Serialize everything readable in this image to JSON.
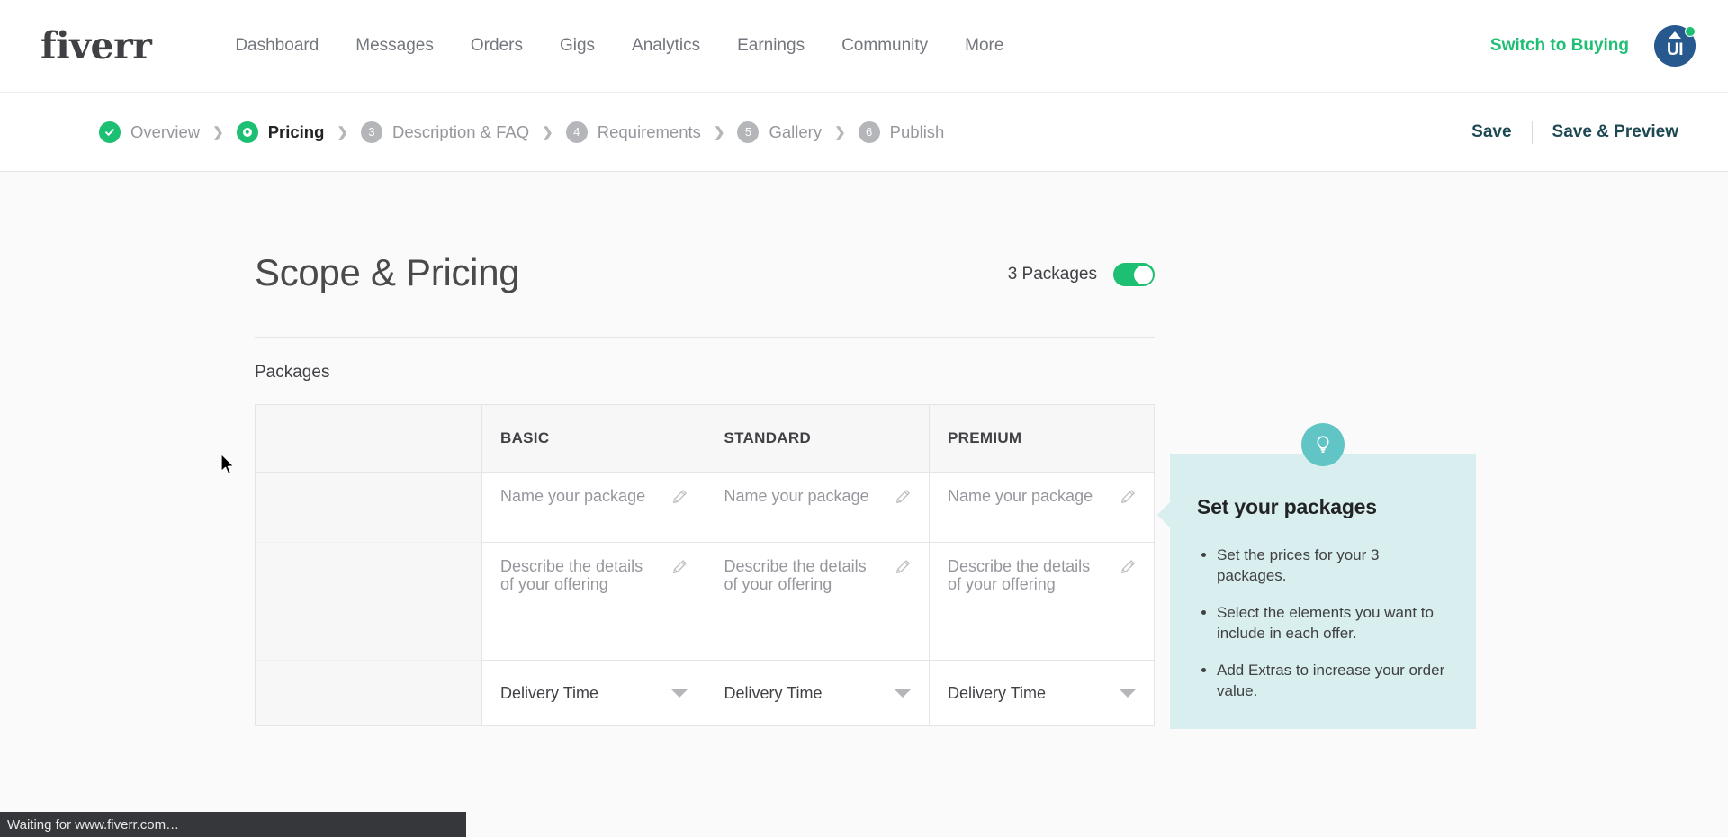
{
  "topnav": {
    "logo": "fiverr",
    "links": [
      {
        "label": "Dashboard"
      },
      {
        "label": "Messages"
      },
      {
        "label": "Orders"
      },
      {
        "label": "Gigs"
      },
      {
        "label": "Analytics"
      },
      {
        "label": "Earnings"
      },
      {
        "label": "Community"
      },
      {
        "label": "More"
      }
    ],
    "switch_to_buying": "Switch to Buying",
    "avatar_initials": "UI",
    "avatar_color": "#27598f",
    "online_dot_color": "#1dbf73"
  },
  "breadcrumb": {
    "separator": "❯",
    "steps": [
      {
        "badge": "check",
        "label": "Overview",
        "state": "done"
      },
      {
        "badge": "pin",
        "label": "Pricing",
        "state": "active"
      },
      {
        "badge": "3",
        "label": "Description & FAQ",
        "state": "todo"
      },
      {
        "badge": "4",
        "label": "Requirements",
        "state": "todo"
      },
      {
        "badge": "5",
        "label": "Gallery",
        "state": "todo"
      },
      {
        "badge": "6",
        "label": "Publish",
        "state": "todo"
      }
    ],
    "actions": {
      "save": "Save",
      "save_preview": "Save & Preview"
    },
    "action_color": "#1d4852"
  },
  "main": {
    "page_title": "Scope & Pricing",
    "packages_toggle_label": "3 Packages",
    "packages_toggle_on": true,
    "toggle_color": "#1dbf73",
    "packages_section_label": "Packages",
    "table": {
      "tiers": [
        "BASIC",
        "STANDARD",
        "PREMIUM"
      ],
      "rows": [
        {
          "key": "name",
          "placeholder": "Name your package",
          "icon": "pencil-icon"
        },
        {
          "key": "description",
          "placeholder": "Describe the details of your offering",
          "icon": "pencil-icon"
        },
        {
          "key": "delivery",
          "value": "Delivery Time",
          "icon": "chevron-down-icon"
        }
      ]
    }
  },
  "tip": {
    "icon": "lightbulb-icon",
    "icon_bg": "#62c5c5",
    "panel_bg": "#d9eeee",
    "title": "Set your packages",
    "bullets": [
      "Set the prices for your 3 packages.",
      "Select the elements you want to include in each offer.",
      "Add Extras to increase your order value."
    ]
  },
  "statusbar": {
    "text": "Waiting for www.fiverr.com…"
  }
}
